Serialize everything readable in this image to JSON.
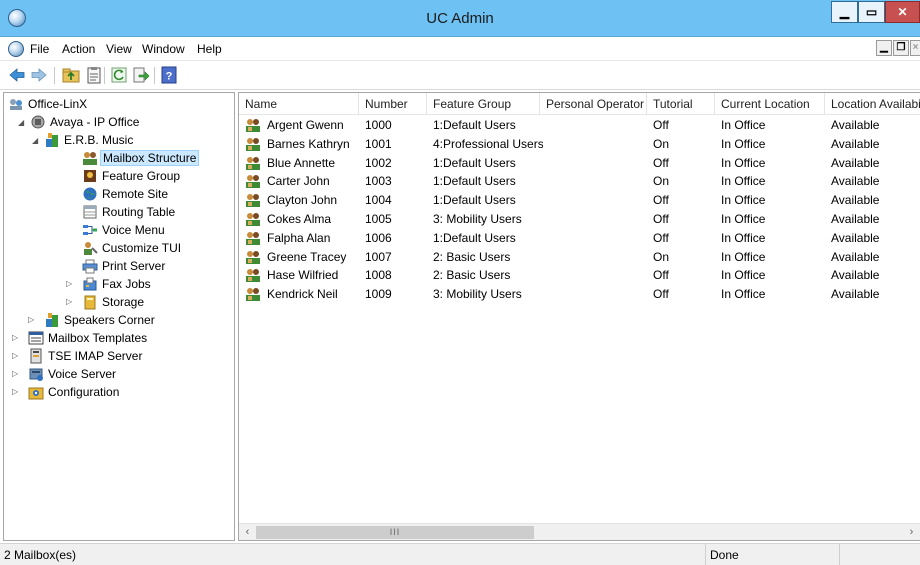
{
  "window": {
    "title": "UC Admin"
  },
  "menu": [
    "File",
    "Action",
    "View",
    "Window",
    "Help"
  ],
  "tree": {
    "root": "Office-LinX",
    "items": [
      {
        "label": "Avaya - IP Office",
        "level": 1,
        "expanded": true
      },
      {
        "label": "E.R.B. Music",
        "level": 2,
        "expanded": true
      },
      {
        "label": "Mailbox Structure",
        "level": 3,
        "selected": true
      },
      {
        "label": "Feature Group",
        "level": 3
      },
      {
        "label": "Remote Site",
        "level": 3
      },
      {
        "label": "Routing Table",
        "level": 3
      },
      {
        "label": "Voice Menu",
        "level": 3
      },
      {
        "label": "Customize TUI",
        "level": 3
      },
      {
        "label": "Print Server",
        "level": 3
      },
      {
        "label": "Fax Jobs",
        "level": 3,
        "expandable": true
      },
      {
        "label": "Storage",
        "level": 3,
        "expandable": true
      },
      {
        "label": "Speakers Corner",
        "level": 2,
        "expandable": true
      },
      {
        "label": "Mailbox Templates",
        "level": 0,
        "expandable": true
      },
      {
        "label": "TSE IMAP Server",
        "level": 0,
        "expandable": true
      },
      {
        "label": "Voice Server",
        "level": 0,
        "expandable": true
      },
      {
        "label": "Configuration",
        "level": 0,
        "expandable": true
      }
    ]
  },
  "list": {
    "columns": [
      "Name",
      "Number",
      "Feature Group",
      "Personal Operator",
      "Tutorial",
      "Current Location",
      "Location Availabi"
    ],
    "rows": [
      [
        "Argent Gwenn",
        "1000",
        "1:Default Users",
        "",
        "Off",
        "In Office",
        "Available"
      ],
      [
        "Barnes Kathryn",
        "1001",
        "4:Professional Users",
        "",
        "On",
        "In Office",
        "Available"
      ],
      [
        "Blue Annette",
        "1002",
        "1:Default Users",
        "",
        "Off",
        "In Office",
        "Available"
      ],
      [
        "Carter John",
        "1003",
        "1:Default Users",
        "",
        "On",
        "In Office",
        "Available"
      ],
      [
        "Clayton John",
        "1004",
        "1:Default Users",
        "",
        "Off",
        "In Office",
        "Available"
      ],
      [
        "Cokes Alma",
        "1005",
        "3: Mobility Users",
        "",
        "Off",
        "In Office",
        "Available"
      ],
      [
        "Falpha Alan",
        "1006",
        "1:Default Users",
        "",
        "Off",
        "In Office",
        "Available"
      ],
      [
        "Greene Tracey",
        "1007",
        "2: Basic Users",
        "",
        "On",
        "In Office",
        "Available"
      ],
      [
        "Hase Wilfried",
        "1008",
        "2: Basic Users",
        "",
        "Off",
        "In Office",
        "Available"
      ],
      [
        "Kendrick Neil",
        "1009",
        "3: Mobility Users",
        "",
        "Off",
        "In Office",
        "Available"
      ]
    ],
    "scroll_grip": "III"
  },
  "status": {
    "left": "2 Mailbox(es)",
    "right": "Done"
  },
  "colors": {
    "titlebar": "#6ec1f3",
    "close": "#c75050",
    "selection": "#cce8ff"
  }
}
